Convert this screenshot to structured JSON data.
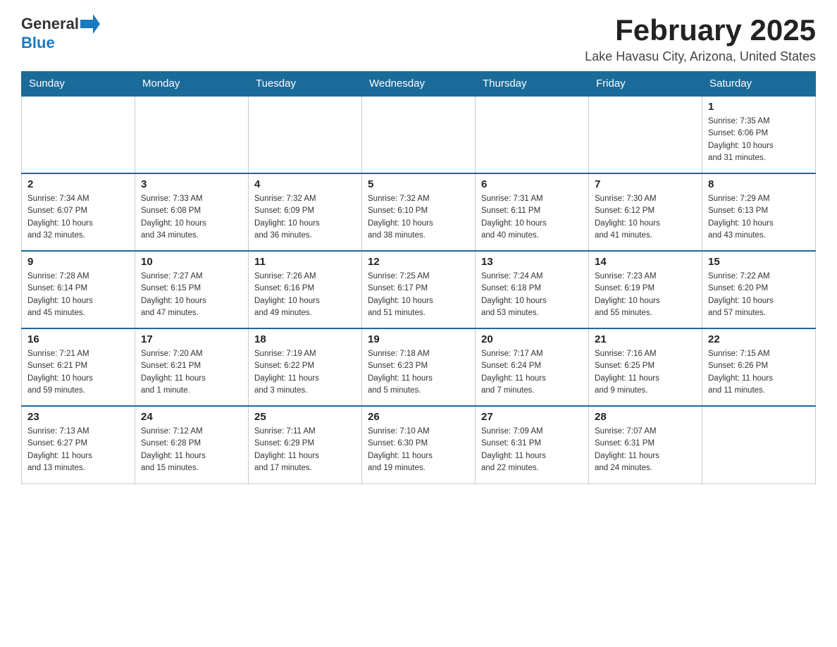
{
  "header": {
    "logo": {
      "text_general": "General",
      "text_blue": "Blue",
      "arrow_color": "#1a7abf"
    },
    "title": "February 2025",
    "location": "Lake Havasu City, Arizona, United States"
  },
  "weekdays": [
    "Sunday",
    "Monday",
    "Tuesday",
    "Wednesday",
    "Thursday",
    "Friday",
    "Saturday"
  ],
  "weeks": [
    {
      "days": [
        {
          "num": "",
          "info": ""
        },
        {
          "num": "",
          "info": ""
        },
        {
          "num": "",
          "info": ""
        },
        {
          "num": "",
          "info": ""
        },
        {
          "num": "",
          "info": ""
        },
        {
          "num": "",
          "info": ""
        },
        {
          "num": "1",
          "info": "Sunrise: 7:35 AM\nSunset: 6:06 PM\nDaylight: 10 hours\nand 31 minutes."
        }
      ]
    },
    {
      "days": [
        {
          "num": "2",
          "info": "Sunrise: 7:34 AM\nSunset: 6:07 PM\nDaylight: 10 hours\nand 32 minutes."
        },
        {
          "num": "3",
          "info": "Sunrise: 7:33 AM\nSunset: 6:08 PM\nDaylight: 10 hours\nand 34 minutes."
        },
        {
          "num": "4",
          "info": "Sunrise: 7:32 AM\nSunset: 6:09 PM\nDaylight: 10 hours\nand 36 minutes."
        },
        {
          "num": "5",
          "info": "Sunrise: 7:32 AM\nSunset: 6:10 PM\nDaylight: 10 hours\nand 38 minutes."
        },
        {
          "num": "6",
          "info": "Sunrise: 7:31 AM\nSunset: 6:11 PM\nDaylight: 10 hours\nand 40 minutes."
        },
        {
          "num": "7",
          "info": "Sunrise: 7:30 AM\nSunset: 6:12 PM\nDaylight: 10 hours\nand 41 minutes."
        },
        {
          "num": "8",
          "info": "Sunrise: 7:29 AM\nSunset: 6:13 PM\nDaylight: 10 hours\nand 43 minutes."
        }
      ]
    },
    {
      "days": [
        {
          "num": "9",
          "info": "Sunrise: 7:28 AM\nSunset: 6:14 PM\nDaylight: 10 hours\nand 45 minutes."
        },
        {
          "num": "10",
          "info": "Sunrise: 7:27 AM\nSunset: 6:15 PM\nDaylight: 10 hours\nand 47 minutes."
        },
        {
          "num": "11",
          "info": "Sunrise: 7:26 AM\nSunset: 6:16 PM\nDaylight: 10 hours\nand 49 minutes."
        },
        {
          "num": "12",
          "info": "Sunrise: 7:25 AM\nSunset: 6:17 PM\nDaylight: 10 hours\nand 51 minutes."
        },
        {
          "num": "13",
          "info": "Sunrise: 7:24 AM\nSunset: 6:18 PM\nDaylight: 10 hours\nand 53 minutes."
        },
        {
          "num": "14",
          "info": "Sunrise: 7:23 AM\nSunset: 6:19 PM\nDaylight: 10 hours\nand 55 minutes."
        },
        {
          "num": "15",
          "info": "Sunrise: 7:22 AM\nSunset: 6:20 PM\nDaylight: 10 hours\nand 57 minutes."
        }
      ]
    },
    {
      "days": [
        {
          "num": "16",
          "info": "Sunrise: 7:21 AM\nSunset: 6:21 PM\nDaylight: 10 hours\nand 59 minutes."
        },
        {
          "num": "17",
          "info": "Sunrise: 7:20 AM\nSunset: 6:21 PM\nDaylight: 11 hours\nand 1 minute."
        },
        {
          "num": "18",
          "info": "Sunrise: 7:19 AM\nSunset: 6:22 PM\nDaylight: 11 hours\nand 3 minutes."
        },
        {
          "num": "19",
          "info": "Sunrise: 7:18 AM\nSunset: 6:23 PM\nDaylight: 11 hours\nand 5 minutes."
        },
        {
          "num": "20",
          "info": "Sunrise: 7:17 AM\nSunset: 6:24 PM\nDaylight: 11 hours\nand 7 minutes."
        },
        {
          "num": "21",
          "info": "Sunrise: 7:16 AM\nSunset: 6:25 PM\nDaylight: 11 hours\nand 9 minutes."
        },
        {
          "num": "22",
          "info": "Sunrise: 7:15 AM\nSunset: 6:26 PM\nDaylight: 11 hours\nand 11 minutes."
        }
      ]
    },
    {
      "days": [
        {
          "num": "23",
          "info": "Sunrise: 7:13 AM\nSunset: 6:27 PM\nDaylight: 11 hours\nand 13 minutes."
        },
        {
          "num": "24",
          "info": "Sunrise: 7:12 AM\nSunset: 6:28 PM\nDaylight: 11 hours\nand 15 minutes."
        },
        {
          "num": "25",
          "info": "Sunrise: 7:11 AM\nSunset: 6:29 PM\nDaylight: 11 hours\nand 17 minutes."
        },
        {
          "num": "26",
          "info": "Sunrise: 7:10 AM\nSunset: 6:30 PM\nDaylight: 11 hours\nand 19 minutes."
        },
        {
          "num": "27",
          "info": "Sunrise: 7:09 AM\nSunset: 6:31 PM\nDaylight: 11 hours\nand 22 minutes."
        },
        {
          "num": "28",
          "info": "Sunrise: 7:07 AM\nSunset: 6:31 PM\nDaylight: 11 hours\nand 24 minutes."
        },
        {
          "num": "",
          "info": ""
        }
      ]
    }
  ]
}
